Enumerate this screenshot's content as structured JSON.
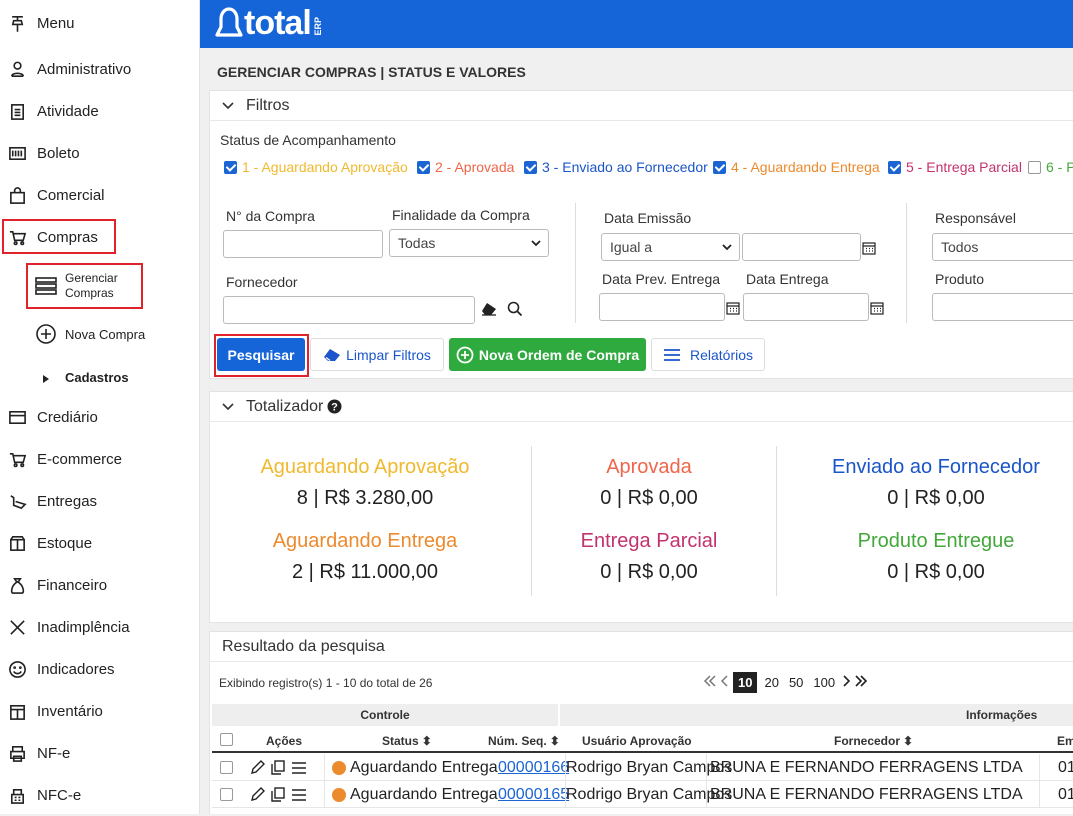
{
  "sidebar": {
    "menu_label": "Menu",
    "items": [
      {
        "label": "Administrativo",
        "icon": "person-network-icon"
      },
      {
        "label": "Atividade",
        "icon": "clipboard-icon"
      },
      {
        "label": "Boleto",
        "icon": "barcode-icon"
      },
      {
        "label": "Comercial",
        "icon": "shopping-bag-icon"
      },
      {
        "label": "Compras",
        "icon": "cart-icon"
      },
      {
        "label": "Crediário",
        "icon": "credit-card-icon"
      },
      {
        "label": "E-commerce",
        "icon": "cart-icon"
      },
      {
        "label": "Entregas",
        "icon": "delivery-icon"
      },
      {
        "label": "Estoque",
        "icon": "box-icon"
      },
      {
        "label": "Financeiro",
        "icon": "money-bag-icon"
      },
      {
        "label": "Inadimplência",
        "icon": "tools-icon"
      },
      {
        "label": "Indicadores",
        "icon": "smile-icon"
      },
      {
        "label": "Inventário",
        "icon": "inventory-icon"
      },
      {
        "label": "NF-e",
        "icon": "printer-icon"
      },
      {
        "label": "NFC-e",
        "icon": "register-icon"
      }
    ],
    "sub": {
      "gerenciar": "Gerenciar\nCompras",
      "nova": "Nova Compra",
      "cadastros": "Cadastros"
    }
  },
  "topbar": {
    "logo_text": "total",
    "logo_sub": "ERP"
  },
  "page_title": "GERENCIAR COMPRAS | STATUS E VALORES",
  "filters": {
    "title": "Filtros",
    "status_label": "Status de Acompanhamento",
    "statuses": [
      {
        "label": "1 - Aguardando Aprovação",
        "color": "#f0b92e",
        "checked": true
      },
      {
        "label": "2 - Aprovada",
        "color": "#f0654b",
        "checked": true
      },
      {
        "label": "3 - Enviado ao Fornecedor",
        "color": "#1a55c9",
        "checked": true
      },
      {
        "label": "4 - Aguardando Entrega",
        "color": "#ec8a2e",
        "checked": true
      },
      {
        "label": "5 - Entrega Parcial",
        "color": "#c2336d",
        "checked": true
      },
      {
        "label": "6 - P",
        "color": "#43a83a",
        "checked": false
      }
    ],
    "num_compra": "N° da Compra",
    "finalidade": "Finalidade da Compra",
    "finalidade_value": "Todas",
    "fornecedor": "Fornecedor",
    "data_emissao": "Data Emissão",
    "data_emissao_op": "Igual a",
    "data_prev": "Data Prev. Entrega",
    "data_entrega": "Data Entrega",
    "responsavel": "Responsável",
    "responsavel_value": "Todos",
    "produto": "Produto",
    "btn_pesquisar": "Pesquisar",
    "btn_limpar": "Limpar Filtros",
    "btn_nova": "Nova Ordem de Compra",
    "btn_relatorios": "Relatórios"
  },
  "totalizador": {
    "title": "Totalizador",
    "items": [
      {
        "title": "Aguardando Aprovação",
        "value": "8 | R$ 3.280,00",
        "color": "#f0b92e"
      },
      {
        "title": "Aprovada",
        "value": "0 | R$ 0,00",
        "color": "#f0654b"
      },
      {
        "title": "Enviado ao Fornecedor",
        "value": "0 | R$ 0,00",
        "color": "#1a55c9"
      },
      {
        "title": "Aguardando Entrega",
        "value": "2 | R$ 11.000,00",
        "color": "#ec8a2e"
      },
      {
        "title": "Entrega Parcial",
        "value": "0 | R$ 0,00",
        "color": "#c2336d"
      },
      {
        "title": "Produto Entregue",
        "value": "0 | R$ 0,00",
        "color": "#43a83a"
      }
    ]
  },
  "results": {
    "title": "Resultado da pesquisa",
    "showing": "Exibindo registro(s) 1 - 10 do total de 26",
    "page_sizes": [
      "10",
      "20",
      "50",
      "100"
    ],
    "group_controle": "Controle",
    "group_info": "Informações",
    "cols": {
      "acoes": "Ações",
      "status": "Status",
      "num_seq": "Núm. Seq.",
      "usuario": "Usuário Aprovação",
      "fornecedor": "Fornecedor",
      "em": "Em"
    },
    "rows": [
      {
        "status": "Aguardando Entrega",
        "num": "00000166",
        "usuario": "Rodrigo Bryan Campos",
        "fornecedor": "BRUNA E FERNANDO FERRAGENS LTDA",
        "em": "01/"
      },
      {
        "status": "Aguardando Entrega",
        "num": "00000165",
        "usuario": "Rodrigo Bryan Campos",
        "fornecedor": "BRUNA E FERNANDO FERRAGENS LTDA",
        "em": "01/"
      }
    ]
  }
}
